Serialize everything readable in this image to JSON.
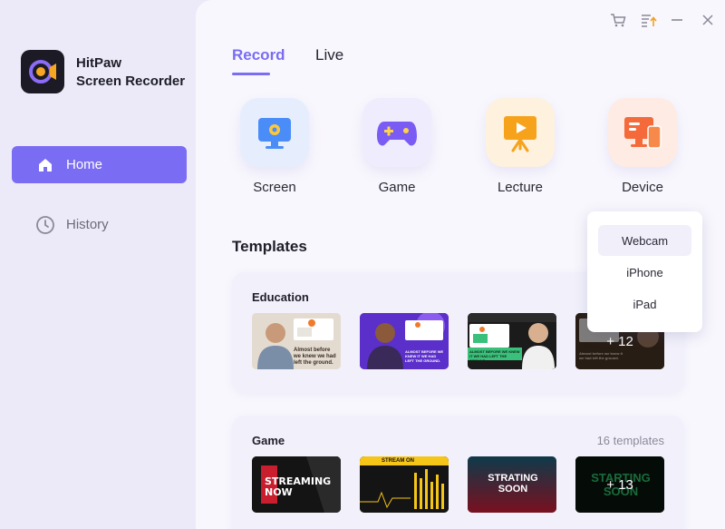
{
  "app": {
    "name_line1": "HitPaw",
    "name_line2": "Screen Recorder"
  },
  "sidebar": {
    "items": [
      {
        "label": "Home",
        "icon": "home-icon",
        "active": true
      },
      {
        "label": "History",
        "icon": "clock-icon",
        "active": false
      }
    ]
  },
  "tabs": [
    {
      "label": "Record",
      "active": true
    },
    {
      "label": "Live",
      "active": false
    }
  ],
  "record_modes": [
    {
      "label": "Screen",
      "icon": "monitor-icon"
    },
    {
      "label": "Game",
      "icon": "gamepad-icon"
    },
    {
      "label": "Lecture",
      "icon": "presentation-icon"
    },
    {
      "label": "Device",
      "icon": "device-icon"
    }
  ],
  "templates": {
    "title": "Templates",
    "education": {
      "title": "Education",
      "more_overlay": "+ 12",
      "thumb_texts": [
        "Almost before we knew we had left the ground.",
        "ALMOST BEFORE WE KNEW IT WE HAD LEFT THE GROUND.",
        "ALMOST BEFORE WE KNEW IT WE HAD LEFT THE GROUND.",
        "Almost before we knew it we had left the ground."
      ]
    },
    "game": {
      "title": "Game",
      "count": "16 templates",
      "more_overlay": "+ 13",
      "thumb_texts": [
        "STREAMING NOW",
        "STREAM ON",
        "STRATING SOON",
        "STARTING SOON"
      ]
    }
  },
  "device_dropdown": {
    "options": [
      "Webcam",
      "iPhone",
      "iPad"
    ],
    "highlighted": "Webcam"
  },
  "colors": {
    "accent": "#7a6cf3",
    "sidebar_bg": "#eceaf8",
    "main_bg": "#f8f7fd"
  }
}
